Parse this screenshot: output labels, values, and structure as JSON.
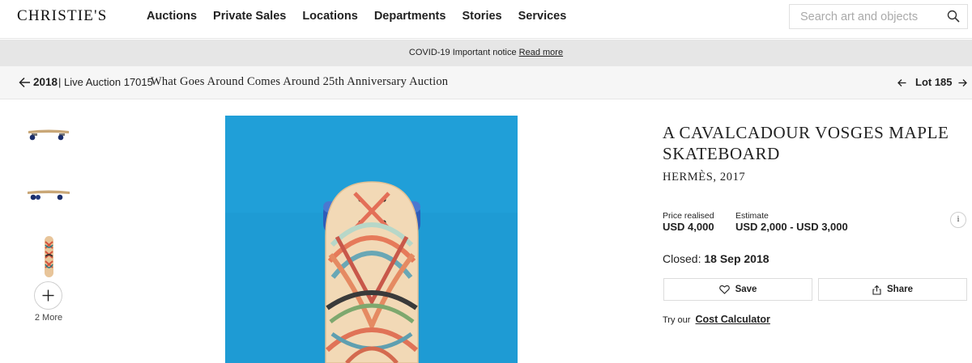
{
  "header": {
    "logo": "CHRISTIE'S",
    "nav": [
      "Auctions",
      "Private Sales",
      "Locations",
      "Departments",
      "Stories",
      "Services"
    ],
    "search_placeholder": "Search art and objects"
  },
  "notice": {
    "text": "COVID-19 Important notice",
    "link": "Read more"
  },
  "breadcrumb": {
    "year": "2018",
    "separator": "|",
    "live_auction": "Live Auction 17015",
    "auction_title": "What Goes Around Comes Around 25th Anniversary Auction",
    "lot": "Lot 185"
  },
  "thumbnails": {
    "more_label": "2 More"
  },
  "lot": {
    "title": "A CAVALCADOUR VOSGES MAPLE SKATEBOARD",
    "maker": "HERMÈS, 2017",
    "price_realised_label": "Price realised",
    "price_realised": "USD 4,000",
    "estimate_label": "Estimate",
    "estimate": "USD 2,000 - USD 3,000",
    "info_label": "i",
    "closed_label": "Closed:",
    "closed_date": "18 Sep 2018",
    "save_label": "Save",
    "share_label": "Share",
    "calc_prefix": "Try our",
    "calc_link": "Cost Calculator"
  },
  "colors": {
    "image_background": "#1e9bd4",
    "notice_bar": "#e6e6e6",
    "crumb_bar": "#f6f6f6"
  }
}
